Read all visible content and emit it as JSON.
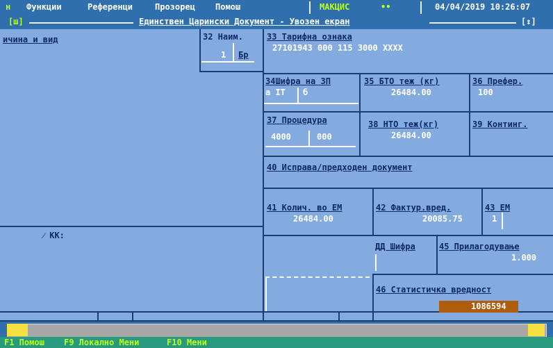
{
  "menubar": {
    "items": [
      "н",
      "Функции",
      "Референци",
      "Прозорец",
      "Помош"
    ],
    "user": "МАКЦИС",
    "indicator": "••",
    "datetime": "04/04/2019 10:26:07"
  },
  "titlebar": {
    "left_box": "[ш]",
    "title": "Единствен Царински Документ - Увозен екран",
    "right_box": "[↕]"
  },
  "fields": {
    "reason_label": "ичина и вид",
    "f32_label": "32 Наим.",
    "f32_value": "1",
    "f32_br": "Бр",
    "f33_label": "33 Тарифна ознака",
    "f33_value": "27101943  000 115 3000 XXXX",
    "f34_label": "34Шифра на ЗП",
    "f34_a": "а IT",
    "f34_b": "б",
    "f35_label": "35 БТО теж (кг)",
    "f35_value": "26484.00",
    "f36_label": "36 Префер.",
    "f36_value": "100",
    "f37_label": "37 Процедура",
    "f37_value_a": "4000",
    "f37_value_b": "000",
    "f38_label": "38 НТО теж(кг)",
    "f38_value": "26484.00",
    "f39_label": "39 Континг.",
    "f40_label": "40 Исправа/предходен документ",
    "f41_label": "41 Колич. во ЕМ",
    "f41_value": "26484.00",
    "f42_label": "42 Фактур.вред.",
    "f42_value": "20085.75",
    "f43_label": "43 ЕМ",
    "f43_value": "1",
    "kk_label": "⁄ КК:",
    "dd_label": "ДД Шифра",
    "f45_label": "45 Прилагодување",
    "f45_value": "1.000",
    "f46_label": "46 Статистичка вредност",
    "f46_value": "1086594"
  },
  "fkeys": {
    "f1": "F1 Помош",
    "f9": "F9 Локално Мени",
    "f10": "F10 Мени"
  },
  "colors": {
    "background": "#83abe0",
    "menubar": "#2f6fae",
    "hotkey": "#b9ff1e",
    "fkeys_bar": "#2a9a7e",
    "highlight_field": "#b05c0d",
    "scroll_thumb": "#f5e042"
  }
}
